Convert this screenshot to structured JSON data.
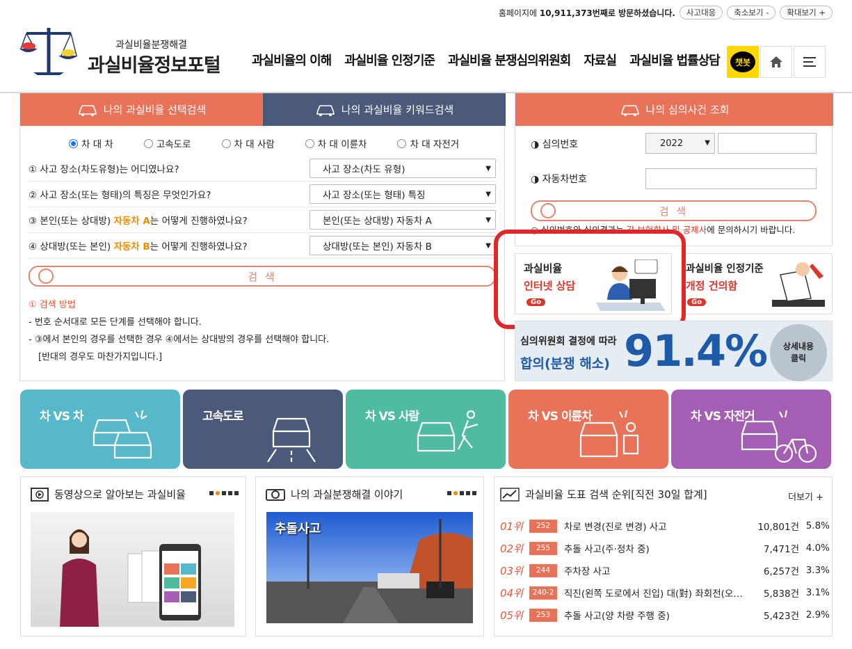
{
  "topbar": {
    "visit_prefix": "홈페이지에 ",
    "visit_count": "10,911,373번째",
    "visit_suffix": "로 방문하셨습니다.",
    "buttons": [
      "사고대응",
      "축소보기 -",
      "확대보기 +"
    ]
  },
  "logo": {
    "sub": "과실비율분쟁해결",
    "main": "과실비율정보포털"
  },
  "gnb": [
    "과실비율의 이해",
    "과실비율 인정기준",
    "과실비율 분쟁심의위원회",
    "자료실",
    "과실비율 법률상담"
  ],
  "header_icons": {
    "chatbot": "챗봇",
    "home": "home-icon",
    "menu": "menu-icon"
  },
  "search": {
    "tabs": [
      "나의 과실비율 선택검색",
      "나의 과실비율 키워드검색"
    ],
    "radios": [
      "차 대 차",
      "고속도로",
      "차 대 사람",
      "차 대 이륜차",
      "차 대 자전거"
    ],
    "selected_radio": 0,
    "questions": [
      {
        "pre": "① 사고 장소(차도유형)는 어디였나요?",
        "hl": "",
        "post": "",
        "select": "사고 장소(차도 유형)"
      },
      {
        "pre": "② 사고 장소(또는 형태)의 특징은 무엇인가요?",
        "hl": "",
        "post": "",
        "select": "사고 장소(또는 형태) 특징"
      },
      {
        "pre": "③ 본인(또는 상대방) ",
        "hl": "자동차 A",
        "post": "는 어떻게 진행하였나요?",
        "select": "본인(또는 상대방) 자동차 A"
      },
      {
        "pre": "④ 상대방(또는 본인) ",
        "hl": "자동차 B",
        "post": "는 어떻게 진행하였나요?",
        "select": "상대방(또는 본인) 자동차 B"
      }
    ],
    "button": "검 색",
    "guide_title": "① 검색 방법",
    "guide": [
      "- 번호 순서대로 모든 단계를 선택해야 합니다.",
      "- ③에서 본인의 경우를 선택한 경우 ④에서는 상대방의 경우를 선택해야 합니다.",
      "[반대의 경우도 마찬가지입니다.]"
    ]
  },
  "lookup": {
    "tab": "나의 심의사건 조회",
    "label1": "◑ 심의번호",
    "year": "2022",
    "label2": "◑ 자동차번호",
    "button": "검 색",
    "note_pre": "○ 심의번호와 심의결과는 ",
    "note_link": "각 보험회사 및 공제사",
    "note_post": "에 문의하시기 바랍니다."
  },
  "banners": [
    {
      "t1": "과실비율",
      "t2": "인터넷 상담",
      "go": "Go"
    },
    {
      "t1": "과실비율 인정기준",
      "t2": "개정 건의함",
      "go": "Go"
    }
  ],
  "stat": {
    "l1": "심의위원회 결정에 따라",
    "l2": "합의(분쟁 해소)",
    "value": "91.4%",
    "btn1": "상세내용",
    "btn2": "클릭"
  },
  "categories": [
    {
      "label": "차 VS 차",
      "color": "#56b8c9"
    },
    {
      "label": "고속도로",
      "color": "#4b5a7a"
    },
    {
      "label": "차 VS 사람",
      "color": "#4fbba0"
    },
    {
      "label": "차 VS 이륜차",
      "color": "#e97358"
    },
    {
      "label": "차 VS 자전거",
      "color": "#a45fb4"
    }
  ],
  "video": {
    "title": "동영상으로 알아보는 과실비율"
  },
  "story": {
    "title": "나의 과실분쟁해결 이야기",
    "caption": "추돌사고"
  },
  "ranking": {
    "title": "과실비율 도표 검색 순위[직전 30일 합계]",
    "more": "더보기 +",
    "rows": [
      {
        "no": "01위",
        "code": "252",
        "title": "차로 변경(진로 변경) 사고",
        "count": "10,801건",
        "pct": "5.8%"
      },
      {
        "no": "02위",
        "code": "255",
        "title": "추돌 사고(주·정차 중)",
        "count": "7,471건",
        "pct": "4.0%"
      },
      {
        "no": "03위",
        "code": "244",
        "title": "주차장 사고",
        "count": "6,257건",
        "pct": "3.3%"
      },
      {
        "no": "04위",
        "code": "240-2",
        "title": "직진(왼쪽 도로에서 진입) 대(對) 좌회전(오른쪽 도로에서 진입)",
        "count": "5,838건",
        "pct": "3.1%"
      },
      {
        "no": "05위",
        "code": "253",
        "title": "추돌 사고(양 차량 주행 중)",
        "count": "5,423건",
        "pct": "2.9%"
      }
    ]
  }
}
